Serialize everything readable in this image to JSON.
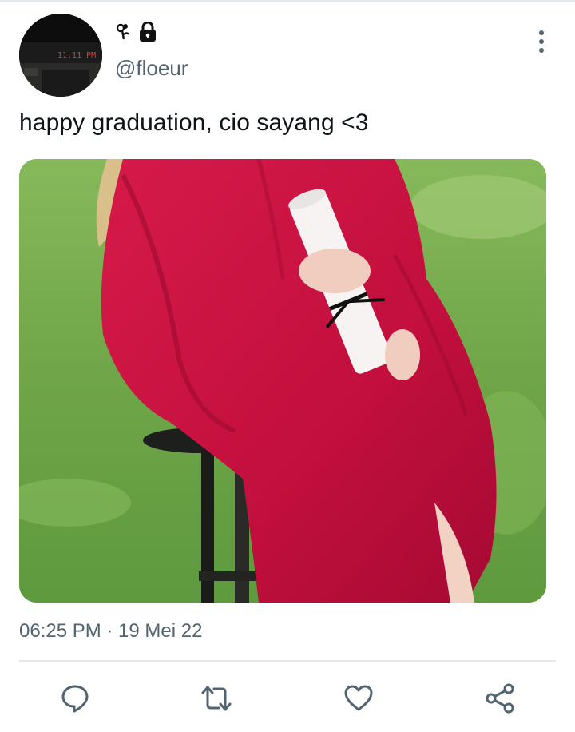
{
  "tweet": {
    "display_name_icons": [
      "flower-emoji-icon",
      "lock-icon"
    ],
    "handle": "@floeur",
    "avatar_clock_text": "11:11 PM",
    "text": "happy graduation, cio sayang <3",
    "timestamp": "06:25 PM · 19 Mei 22"
  },
  "actions": [
    "reply-icon",
    "retweet-icon",
    "like-icon",
    "share-icon"
  ],
  "colors": {
    "text_primary": "#0f1419",
    "text_secondary": "#536471",
    "divider": "#e6e9ec",
    "gown": "#c8103f",
    "grass": "#6fa548"
  }
}
